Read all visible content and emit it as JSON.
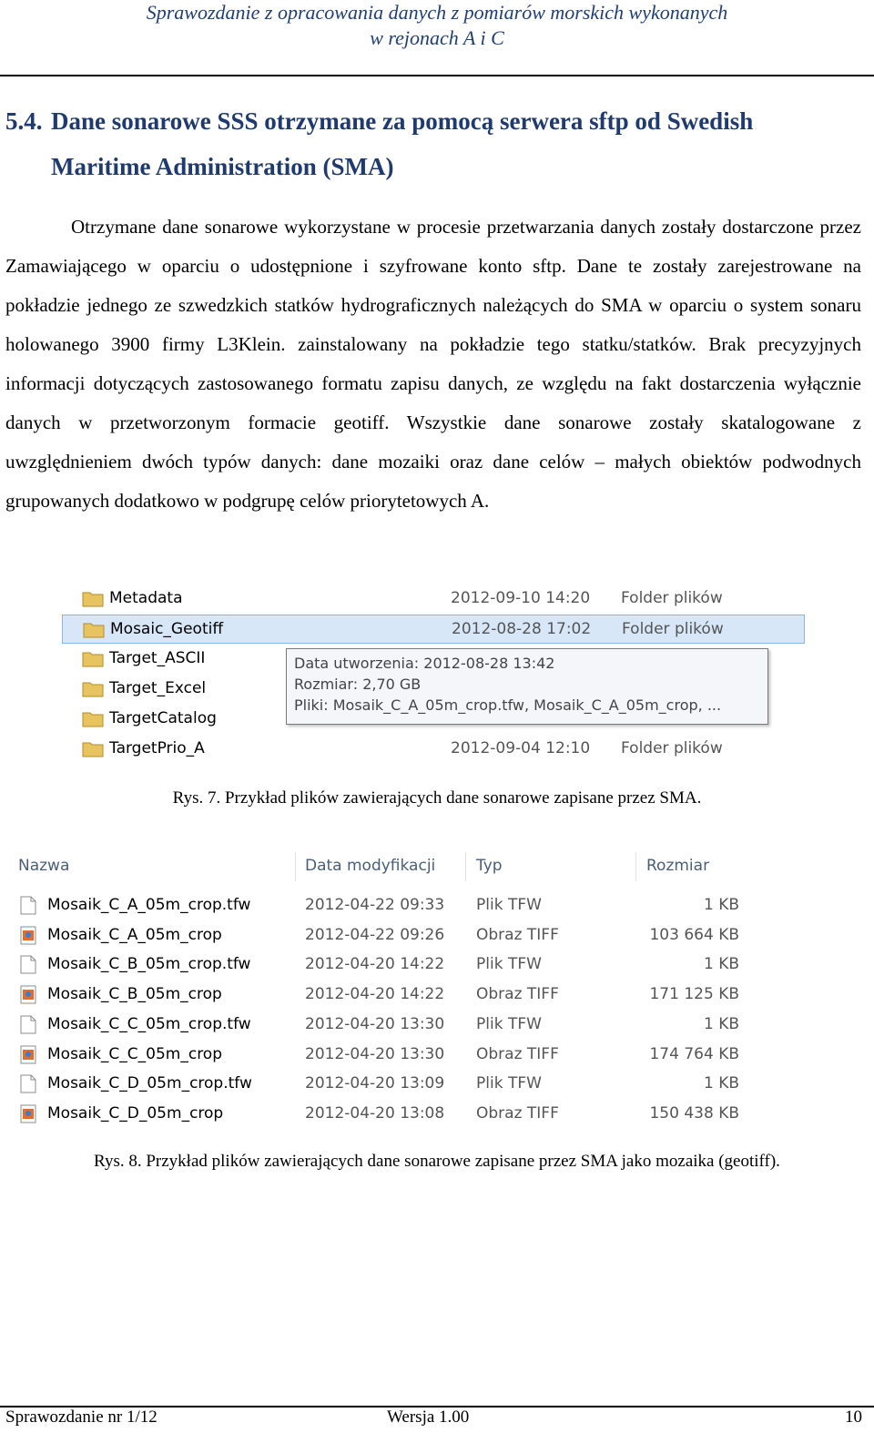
{
  "header": {
    "line1": "Sprawozdanie z opracowania danych z pomiarów morskich wykonanych",
    "line2": "w rejonach A i C"
  },
  "section": {
    "number": "5.4.",
    "title_l1": "Dane sonarowe SSS otrzymane za pomocą serwera sftp od Swedish",
    "title_l2": "Maritime Administration (SMA)"
  },
  "paragraph": "Otrzymane dane sonarowe wykorzystane w procesie przetwarzania danych zostały dostarczone przez Zamawiającego w oparciu o udostępnione i szyfrowane konto sftp. Dane te zostały zarejestrowane na pokładzie jednego ze szwedzkich statków hydrograficznych należących do SMA w oparciu o system sonaru holowanego 3900 firmy L3Klein. zainstalowany na pokładzie tego statku/statków. Brak precyzyjnych informacji dotyczących zastosowanego formatu zapisu danych, ze względu na fakt dostarczenia wyłącznie danych w przetworzonym formacie geotiff. Wszystkie dane sonarowe zostały skatalogowane z uwzględnieniem dwóch typów danych: dane mozaiki oraz dane celów – małych obiektów podwodnych grupowanych dodatkowo w podgrupę celów priorytetowych A.",
  "figure1": {
    "rows": [
      {
        "name": "Metadata",
        "date": "2012-09-10 14:20",
        "type": "Folder plików"
      },
      {
        "name": "Mosaic_Geotiff",
        "date": "2012-08-28 17:02",
        "type": "Folder plików"
      },
      {
        "name": "Target_ASCII",
        "date": "",
        "type": ""
      },
      {
        "name": "Target_Excel",
        "date": "",
        "type": ""
      },
      {
        "name": "TargetCatalog",
        "date": "",
        "type": ""
      },
      {
        "name": "TargetPrio_A",
        "date": "2012-09-04 12:10",
        "type": "Folder plików"
      }
    ],
    "tooltip": {
      "created": "Data utworzenia: 2012-08-28 13:42",
      "size": "Rozmiar: 2,70 GB",
      "files": "Pliki: Mosaik_C_A_05m_crop.tfw, Mosaik_C_A_05m_crop, ..."
    },
    "caption": "Rys. 7. Przykład plików zawierających dane sonarowe zapisane przez SMA."
  },
  "figure2": {
    "columns": [
      "Nazwa",
      "Data modyfikacji",
      "Typ",
      "Rozmiar"
    ],
    "rows": [
      {
        "name": "Mosaik_C_A_05m_crop.tfw",
        "date": "2012-04-22 09:33",
        "type": "Plik TFW",
        "size": "1 KB",
        "icon": "file-icon"
      },
      {
        "name": "Mosaik_C_A_05m_crop",
        "date": "2012-04-22 09:26",
        "type": "Obraz TIFF",
        "size": "103 664 KB",
        "icon": "image-icon"
      },
      {
        "name": "Mosaik_C_B_05m_crop.tfw",
        "date": "2012-04-20 14:22",
        "type": "Plik TFW",
        "size": "1 KB",
        "icon": "file-icon"
      },
      {
        "name": "Mosaik_C_B_05m_crop",
        "date": "2012-04-20 14:22",
        "type": "Obraz TIFF",
        "size": "171 125 KB",
        "icon": "image-icon"
      },
      {
        "name": "Mosaik_C_C_05m_crop.tfw",
        "date": "2012-04-20 13:30",
        "type": "Plik TFW",
        "size": "1 KB",
        "icon": "file-icon"
      },
      {
        "name": "Mosaik_C_C_05m_crop",
        "date": "2012-04-20 13:30",
        "type": "Obraz TIFF",
        "size": "174 764 KB",
        "icon": "image-icon"
      },
      {
        "name": "Mosaik_C_D_05m_crop.tfw",
        "date": "2012-04-20 13:09",
        "type": "Plik TFW",
        "size": "1 KB",
        "icon": "file-icon"
      },
      {
        "name": "Mosaik_C_D_05m_crop",
        "date": "2012-04-20 13:08",
        "type": "Obraz TIFF",
        "size": "150 438 KB",
        "icon": "image-icon"
      }
    ],
    "caption": "Rys. 8. Przykład plików zawierających dane sonarowe zapisane przez SMA jako mozaika (geotiff)."
  },
  "footer": {
    "report": "Sprawozdanie nr 1/12",
    "version": "Wersja 1.00",
    "page": "10"
  }
}
